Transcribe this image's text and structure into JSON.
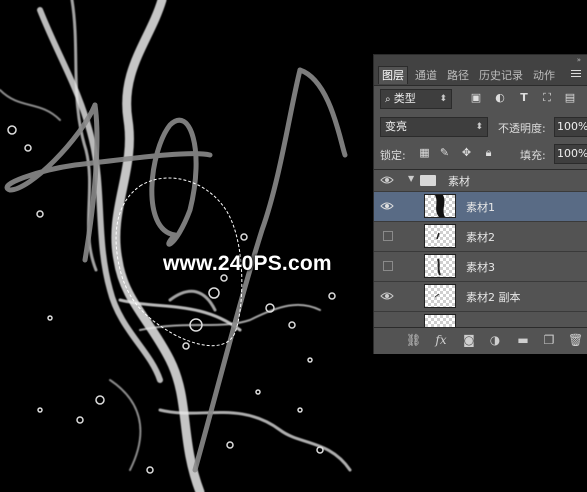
{
  "watermark": "www.240PS.com",
  "layers_panel": {
    "tabs": [
      {
        "label": "图层",
        "active": true
      },
      {
        "label": "通道",
        "active": false
      },
      {
        "label": "路径",
        "active": false
      },
      {
        "label": "历史记录",
        "active": false
      },
      {
        "label": "动作",
        "active": false
      }
    ],
    "filter_kind": "类型",
    "blend_mode": "变亮",
    "opacity_label": "不透明度:",
    "opacity_value": "100%",
    "lock_label": "锁定:",
    "fill_label": "填充:",
    "fill_value": "100%",
    "group_name": "素材",
    "layers": [
      {
        "name": "素材1",
        "visible": true,
        "selected": true
      },
      {
        "name": "素材2",
        "visible": false,
        "selected": false
      },
      {
        "name": "素材3",
        "visible": false,
        "selected": false
      },
      {
        "name": "素材2 副本",
        "visible": true,
        "selected": false
      }
    ]
  },
  "icons": {
    "filter_icons": [
      "image-filter-icon",
      "adjustment-filter-icon",
      "type-filter-icon",
      "shape-filter-icon",
      "smartobject-filter-icon"
    ],
    "lock_icons": [
      "lock-transparent-icon",
      "lock-image-icon",
      "lock-position-icon",
      "lock-all-icon"
    ],
    "footer_icons": [
      "link-icon",
      "fx-icon",
      "mask-icon",
      "adjustment-layer-icon",
      "new-group-icon",
      "new-layer-icon",
      "delete-icon"
    ]
  },
  "colors": {
    "panel_bg": "#535353",
    "selected_layer": "#596b85",
    "canvas_bg": "#000000"
  }
}
